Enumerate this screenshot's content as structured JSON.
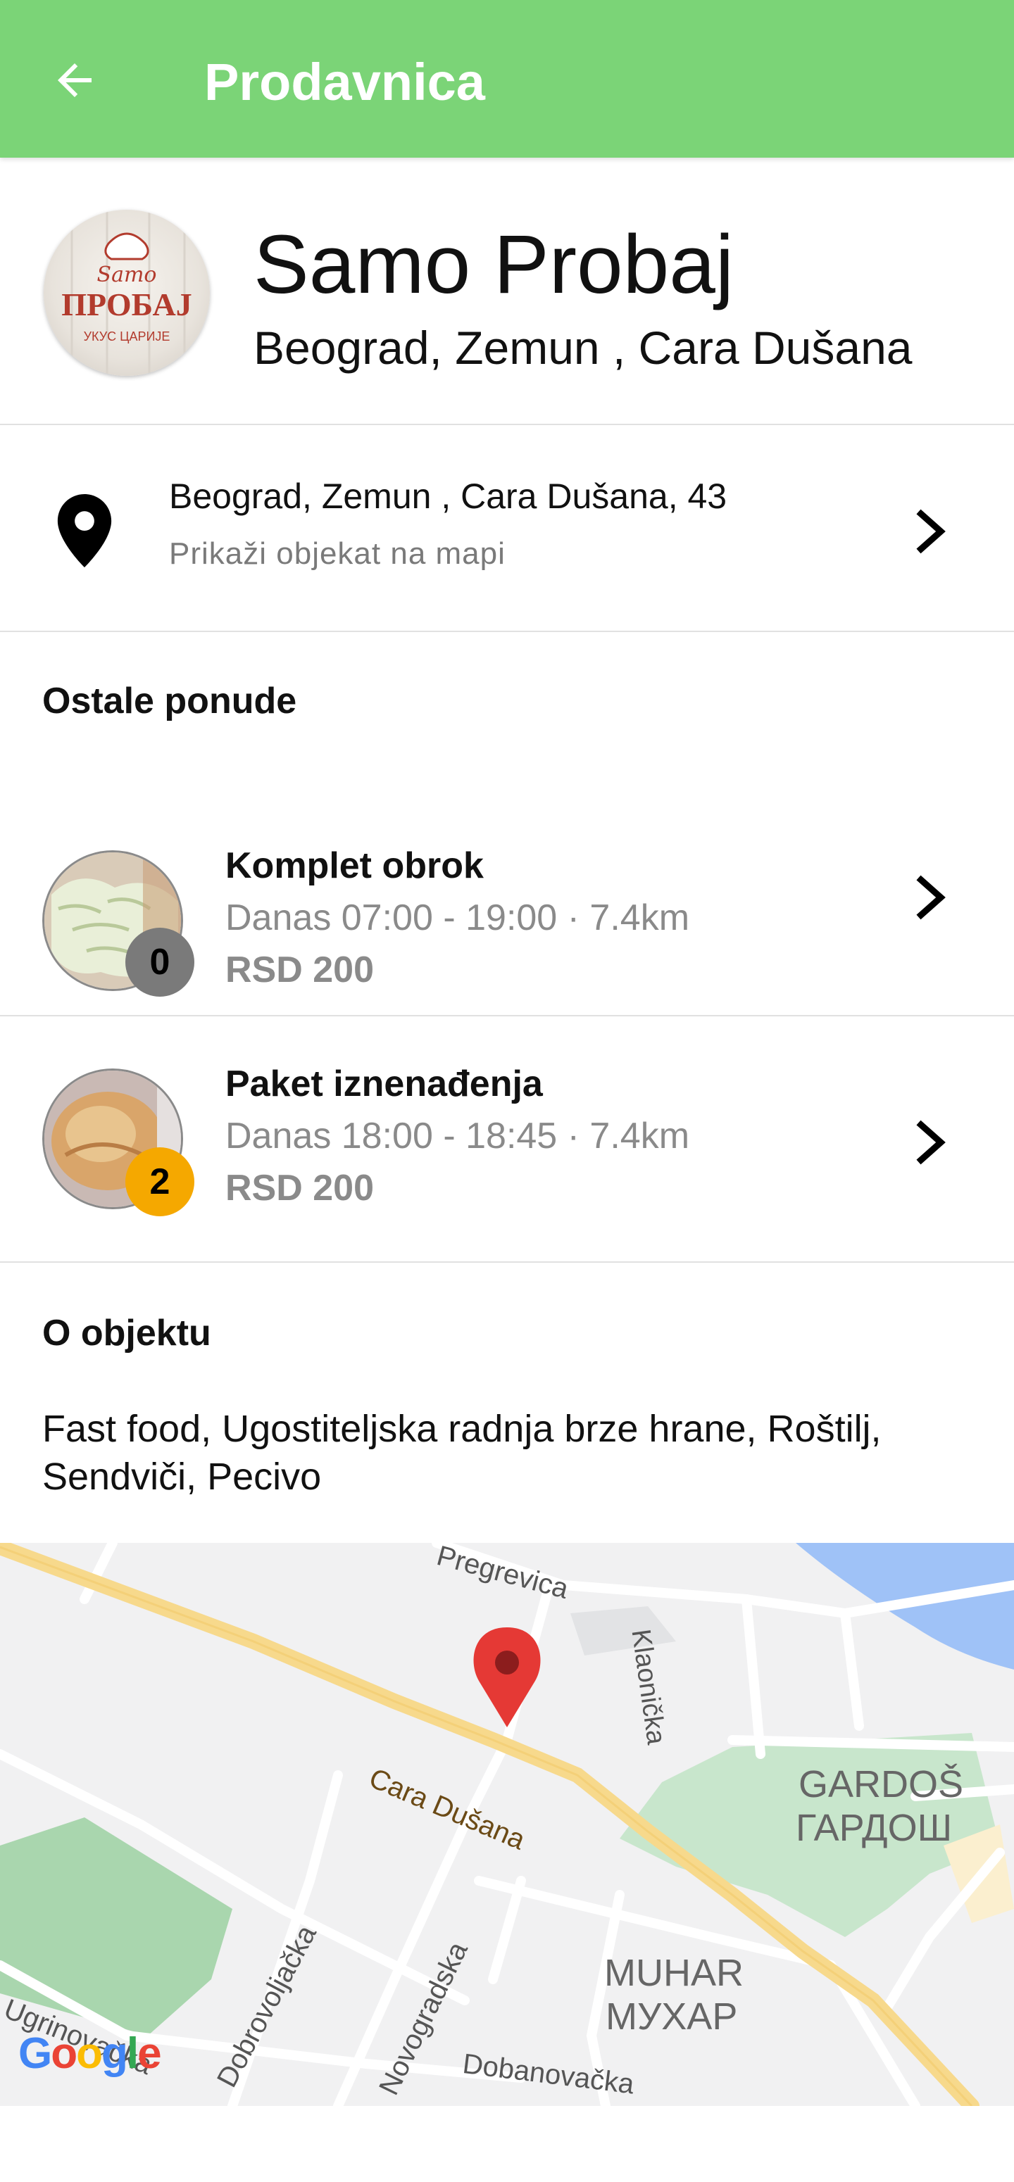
{
  "appbar": {
    "title": "Prodavnica",
    "back_icon": "arrow-left-icon",
    "color": "#7bd477"
  },
  "store": {
    "name": "Samo Probaj",
    "location": "Beograd, Zemun , Cara Dušana",
    "logo_text": [
      "Samo",
      "ПРОБАЈ",
      "УКУС ЦАРИЈЕ"
    ]
  },
  "address": {
    "line": "Beograd, Zemun , Cara Dušana, 43",
    "action": "Prikaži objekat na mapi",
    "icon": "map-pin-icon"
  },
  "offers_section": {
    "title": "Ostale ponude",
    "items": [
      {
        "name": "Komplet obrok",
        "time": "Danas 07:00 - 19:00 · 7.4km",
        "price": "RSD 200",
        "count": "0",
        "badge_color": "#7a7a7a"
      },
      {
        "name": "Paket iznenađenja",
        "time": "Danas 18:00 - 18:45 · 7.4km",
        "price": "RSD 200",
        "count": "2",
        "badge_color": "#f5a800"
      }
    ]
  },
  "about": {
    "title": "O objektu",
    "text": "Fast food, Ugostiteljska radnja brze hrane, Roštilj, Sendviči, Pecivo"
  },
  "map": {
    "labels": {
      "pregrevica": "Pregrevica",
      "klaonicka": "Klaonička",
      "cara_dusana": "Cara Dušana",
      "gardos_latin": "GARDOŠ",
      "gardos_cyr": "ГАРДОШ",
      "muhar_latin": "MUHAR",
      "muhar_cyr": "МУХАР",
      "dobrovoljacka": "Dobrovoljačka",
      "novogradska": "Novogradska",
      "ugrinovacka": "Ugrinovačka",
      "dobanovacka": "Dobanovačka"
    },
    "attribution": "Google",
    "marker_color": "#e53935"
  }
}
